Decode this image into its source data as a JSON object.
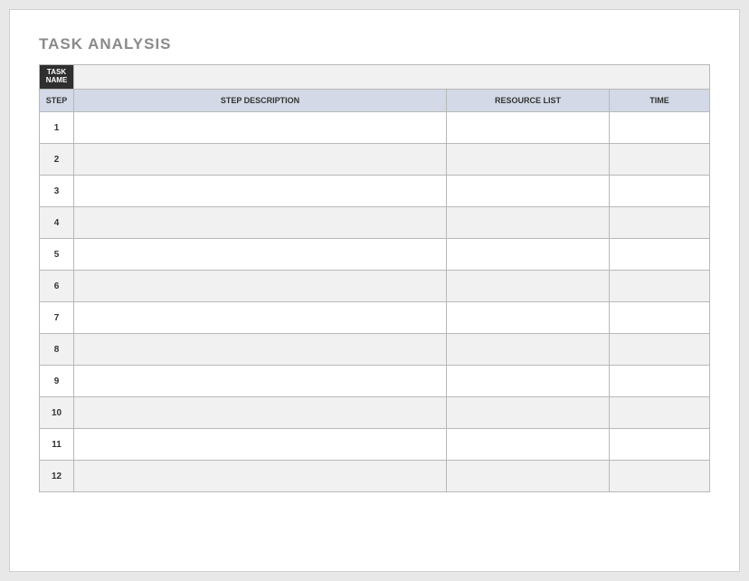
{
  "title": "TASK ANALYSIS",
  "task_name_label": "TASK\nNAME",
  "task_name_value": "",
  "columns": {
    "step": "STEP",
    "desc": "STEP DESCRIPTION",
    "res": "RESOURCE LIST",
    "time": "TIME"
  },
  "rows": [
    {
      "n": "1",
      "desc": "",
      "res": "",
      "time": ""
    },
    {
      "n": "2",
      "desc": "",
      "res": "",
      "time": ""
    },
    {
      "n": "3",
      "desc": "",
      "res": "",
      "time": ""
    },
    {
      "n": "4",
      "desc": "",
      "res": "",
      "time": ""
    },
    {
      "n": "5",
      "desc": "",
      "res": "",
      "time": ""
    },
    {
      "n": "6",
      "desc": "",
      "res": "",
      "time": ""
    },
    {
      "n": "7",
      "desc": "",
      "res": "",
      "time": ""
    },
    {
      "n": "8",
      "desc": "",
      "res": "",
      "time": ""
    },
    {
      "n": "9",
      "desc": "",
      "res": "",
      "time": ""
    },
    {
      "n": "10",
      "desc": "",
      "res": "",
      "time": ""
    },
    {
      "n": "11",
      "desc": "",
      "res": "",
      "time": ""
    },
    {
      "n": "12",
      "desc": "",
      "res": "",
      "time": ""
    }
  ]
}
